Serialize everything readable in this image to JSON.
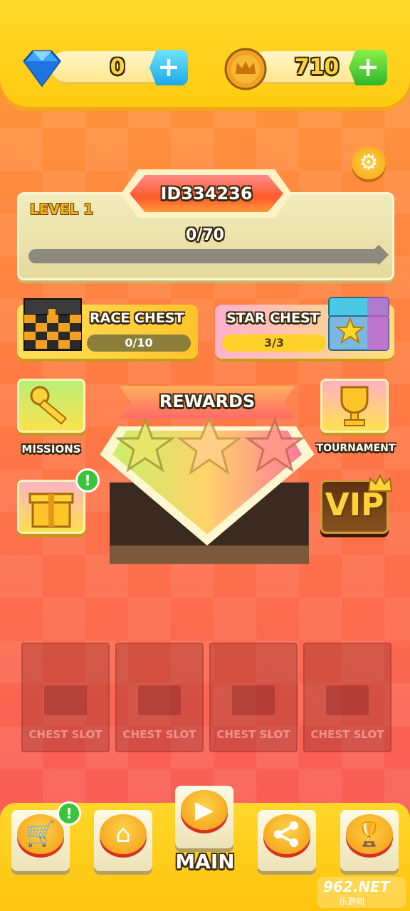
{
  "currency": {
    "gems": {
      "icon": "diamond-icon",
      "value": "0",
      "add_label": "+"
    },
    "coins": {
      "icon": "crown-coin-icon",
      "value": "710",
      "add_label": "+"
    }
  },
  "profile": {
    "id": "ID334236",
    "level_label": "LEVEL 1",
    "progress_text": "0/70",
    "progress_fraction": 0.0
  },
  "chests": {
    "race": {
      "label": "RACE CHEST",
      "progress": "0/10"
    },
    "star": {
      "label": "STAR CHEST",
      "progress": "3/3"
    }
  },
  "side": {
    "missions_label": "MISSIONS",
    "tournament_label": "TOURNAMENT",
    "gift_badge": "!",
    "vip_label": "VIP"
  },
  "rewards": {
    "title": "REWARDS",
    "stars_total": 3
  },
  "slots": [
    "CHEST SLOT",
    "CHEST SLOT",
    "CHEST SLOT",
    "CHEST SLOT"
  ],
  "nav": {
    "shop_badge": "!",
    "main_label": "MAIN"
  },
  "watermark": {
    "brand": "962.NET",
    "sub": "乐游网"
  },
  "colors": {
    "accent": "#ffcb12",
    "bg": "#fb7a4a",
    "green": "#39c43a"
  }
}
